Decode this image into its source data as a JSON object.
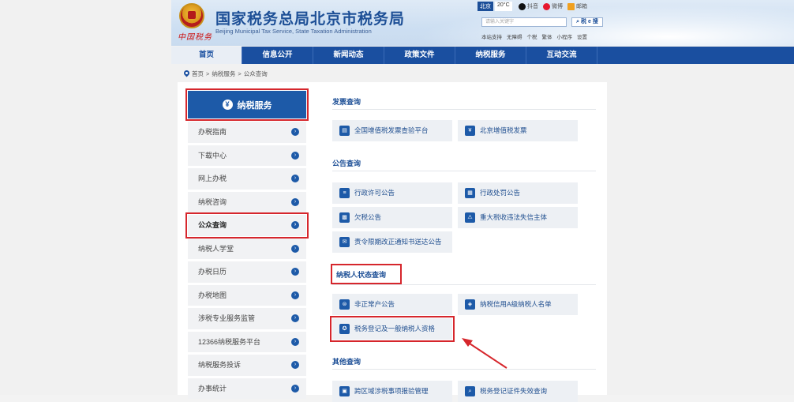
{
  "header": {
    "title": "国家税务总局北京市税务局",
    "subtitle": "Beijing Municipal Tax Service, State Taxation Administration",
    "seal_text": "中国税务",
    "weather": {
      "city": "北京",
      "temp": "20°C"
    },
    "socials": [
      "抖音",
      "微博",
      "邮箱"
    ],
    "search_placeholder": "请输入关键字",
    "search_button": "税 e 搜",
    "top_links": [
      "本站支持",
      "无障碍",
      "个税",
      "繁体",
      "小程序",
      "设置"
    ]
  },
  "nav": [
    "首页",
    "信息公开",
    "新闻动态",
    "政策文件",
    "纳税服务",
    "互动交流"
  ],
  "breadcrumb": [
    "首页",
    ">",
    "纳税服务",
    ">",
    "公众查询"
  ],
  "sidebar": {
    "title": "纳税服务",
    "items": [
      "办税指南",
      "下载中心",
      "网上办税",
      "纳税咨询",
      "公众查询",
      "纳税人学堂",
      "办税日历",
      "办税地图",
      "涉税专业服务监管",
      "12366纳税服务平台",
      "纳税服务投诉",
      "办事统计"
    ]
  },
  "content": {
    "sections": [
      {
        "title": "发票查询",
        "cards": [
          "全国增值税发票查验平台",
          "北京增值税发票"
        ]
      },
      {
        "title": "公告查询",
        "cards": [
          "行政许可公告",
          "行政处罚公告",
          "欠税公告",
          "重大税收违法失信主体",
          "责令限期改正通知书送达公告"
        ]
      },
      {
        "title": "纳税人状态查询",
        "cards": [
          "非正常户公告",
          "纳税信用A级纳税人名单",
          "税务登记及一般纳税人资格"
        ]
      },
      {
        "title": "其他查询",
        "cards": [
          "跨区域涉税事项报验管理",
          "税务登记证件失效查询"
        ]
      }
    ]
  },
  "colors": {
    "brand_blue": "#1a4fa0",
    "highlight_red": "#d6262c"
  },
  "icons": [
    "emblem-icon",
    "pin-icon",
    "service-icon",
    "chevron-right-icon",
    "invoice-icon",
    "notice-icon",
    "user-icon",
    "certificate-icon"
  ]
}
